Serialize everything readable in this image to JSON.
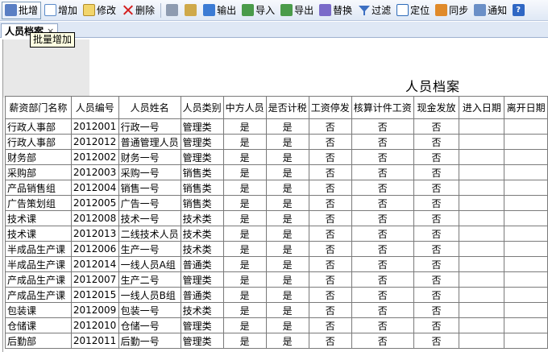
{
  "toolbar": {
    "batch_add": "批增",
    "add": "增加",
    "edit": "修改",
    "delete": "删除",
    "export_out": "输出",
    "import": "导入",
    "export": "导出",
    "replace": "替换",
    "filter": "过滤",
    "locate": "定位",
    "sync": "同步",
    "notify": "通知"
  },
  "tab": {
    "label": "人员档案",
    "close": "×"
  },
  "tooltip": "批量增加",
  "sheet_title": "人员档案",
  "table": {
    "headers": [
      "薪资部门名称",
      "人员编号",
      "人员姓名",
      "人员类别",
      "中方人员",
      "是否计税",
      "工资停发",
      "核算计件工资",
      "现金发放",
      "进入日期",
      "离开日期"
    ],
    "rows": [
      [
        "行政人事部",
        "2012001",
        "行政一号",
        "管理类",
        "是",
        "是",
        "否",
        "否",
        "否",
        "",
        ""
      ],
      [
        "行政人事部",
        "2012012",
        "普通管理人员",
        "管理类",
        "是",
        "是",
        "否",
        "否",
        "否",
        "",
        ""
      ],
      [
        "财务部",
        "2012002",
        "财务一号",
        "管理类",
        "是",
        "是",
        "否",
        "否",
        "否",
        "",
        ""
      ],
      [
        "采购部",
        "2012003",
        "采购一号",
        "销售类",
        "是",
        "是",
        "否",
        "否",
        "否",
        "",
        ""
      ],
      [
        "产品销售组",
        "2012004",
        "销售一号",
        "销售类",
        "是",
        "是",
        "否",
        "否",
        "否",
        "",
        ""
      ],
      [
        "广告策划组",
        "2012005",
        "广告一号",
        "销售类",
        "是",
        "是",
        "否",
        "否",
        "否",
        "",
        ""
      ],
      [
        "技术课",
        "2012008",
        "技术一号",
        "技术类",
        "是",
        "是",
        "否",
        "否",
        "否",
        "",
        ""
      ],
      [
        "技术课",
        "2012013",
        "二线技术人员",
        "技术类",
        "是",
        "是",
        "否",
        "否",
        "否",
        "",
        ""
      ],
      [
        "半成品生产课",
        "2012006",
        "生产一号",
        "技术类",
        "是",
        "是",
        "否",
        "否",
        "否",
        "",
        ""
      ],
      [
        "半成品生产课",
        "2012014",
        "一线人员A组",
        "普通类",
        "是",
        "是",
        "否",
        "否",
        "否",
        "",
        ""
      ],
      [
        "产成品生产课",
        "2012007",
        "生产二号",
        "管理类",
        "是",
        "是",
        "否",
        "否",
        "否",
        "",
        ""
      ],
      [
        "产成品生产课",
        "2012015",
        "一线人员B组",
        "普通类",
        "是",
        "是",
        "否",
        "否",
        "否",
        "",
        ""
      ],
      [
        "包装课",
        "2012009",
        "包装一号",
        "技术类",
        "是",
        "是",
        "否",
        "否",
        "否",
        "",
        ""
      ],
      [
        "仓储课",
        "2012010",
        "仓储一号",
        "管理类",
        "是",
        "是",
        "否",
        "否",
        "否",
        "",
        ""
      ],
      [
        "后勤部",
        "2012011",
        "后勤一号",
        "管理类",
        "是",
        "是",
        "否",
        "否",
        "否",
        "",
        ""
      ]
    ]
  }
}
